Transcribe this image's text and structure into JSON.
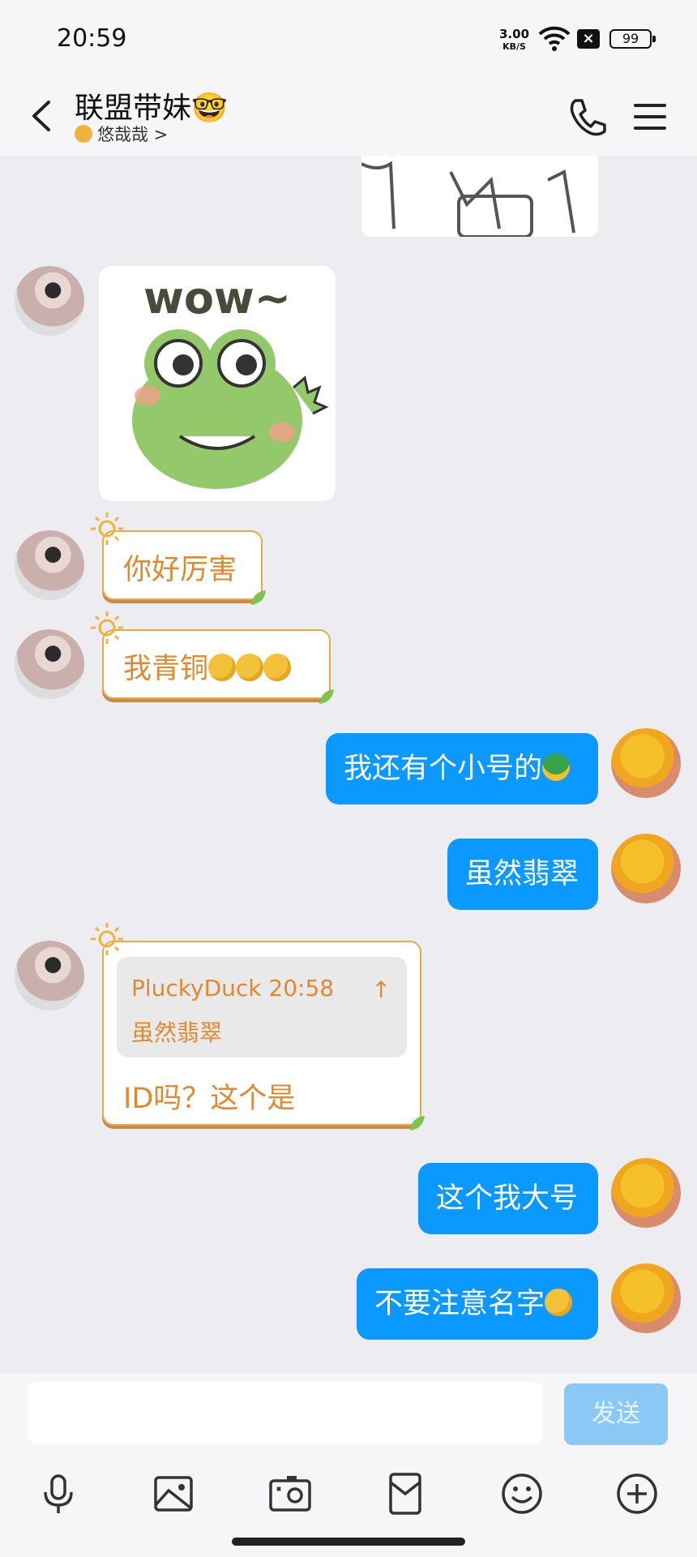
{
  "status_bar": {
    "time": "20:59",
    "net_speed": "3.00",
    "net_unit": "KB/S",
    "battery": "99"
  },
  "header": {
    "title": "联盟带妹🤓",
    "subtitle": "悠哉哉 >"
  },
  "messages": [
    {
      "side": "them",
      "text": "你好厉害"
    },
    {
      "side": "them",
      "text": "我青铜"
    },
    {
      "side": "me",
      "text": "我还有个小号的"
    },
    {
      "side": "me",
      "text": "虽然翡翠"
    },
    {
      "side": "them",
      "quote_name": "PluckyDuck 20:58",
      "quote_up": "↑",
      "quote_text": "虽然翡翠",
      "text": "ID吗？这个是"
    },
    {
      "side": "me",
      "text": "这个我大号"
    },
    {
      "side": "me",
      "text": "不要注意名字"
    }
  ],
  "stickers": {
    "frog_text": "wow~"
  },
  "composer": {
    "send_label": "发送"
  },
  "colors": {
    "me_bubble": "#0b99ff",
    "them_border": "#e9a94a",
    "them_text": "#e2882d"
  },
  "icons": [
    "back-icon",
    "phone-icon",
    "menu-icon",
    "microphone-icon",
    "image-icon",
    "camera-icon",
    "red-packet-icon",
    "emoji-icon",
    "plus-icon"
  ]
}
